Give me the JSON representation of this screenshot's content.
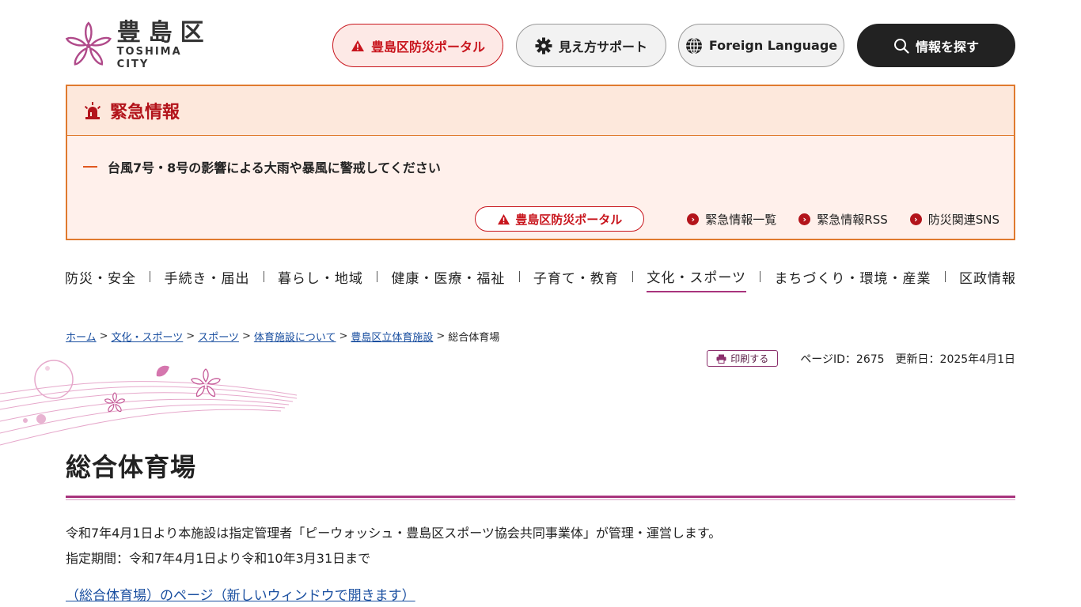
{
  "header": {
    "logo_jp": "豊島区",
    "logo_en": "TOSHIMA CITY",
    "bousai_portal": "豊島区防災ポータル",
    "mie_support": "見え方サポート",
    "foreign_language": "Foreign Language",
    "search": "情報を探す"
  },
  "emergency": {
    "title": "緊急情報",
    "items": [
      "台風7号・8号の影響による大雨や暴風に警戒してください"
    ],
    "portal_link": "豊島区防災ポータル",
    "links": [
      "緊急情報一覧",
      "緊急情報RSS",
      "防災関連SNS"
    ]
  },
  "nav": {
    "items": [
      "防災・安全",
      "手続き・届出",
      "暮らし・地域",
      "健康・医療・福祉",
      "子育て・教育",
      "文化・スポーツ",
      "まちづくり・環境・産業",
      "区政情報"
    ],
    "active": "文化・スポーツ"
  },
  "breadcrumb": {
    "links": [
      "ホーム",
      "文化・スポーツ",
      "スポーツ",
      "体育施設について",
      "豊島区立体育施設"
    ],
    "current": "総合体育場",
    "separator": ">"
  },
  "meta": {
    "print": "印刷する",
    "page_id": "ページID：2675",
    "updated": "更新日：2025年4月1日"
  },
  "page": {
    "title": "総合体育場",
    "paragraph_1": "令和7年4月1日より本施設は指定管理者「ピーウォッシュ・豊島区スポーツ協会共同事業体」が管理・運営します。",
    "paragraph_2": "指定期間：令和7年4月1日より令和10年3月31日まで",
    "link": "（総合体育場）のページ（新しいウィンドウで開きます）"
  },
  "colors": {
    "brand_magenta": "#a8347d",
    "alert_red": "#c8151d",
    "emergency_border": "#e07a2e",
    "emergency_bg": "#fff0eb",
    "link_blue": "#1a4fa0"
  }
}
